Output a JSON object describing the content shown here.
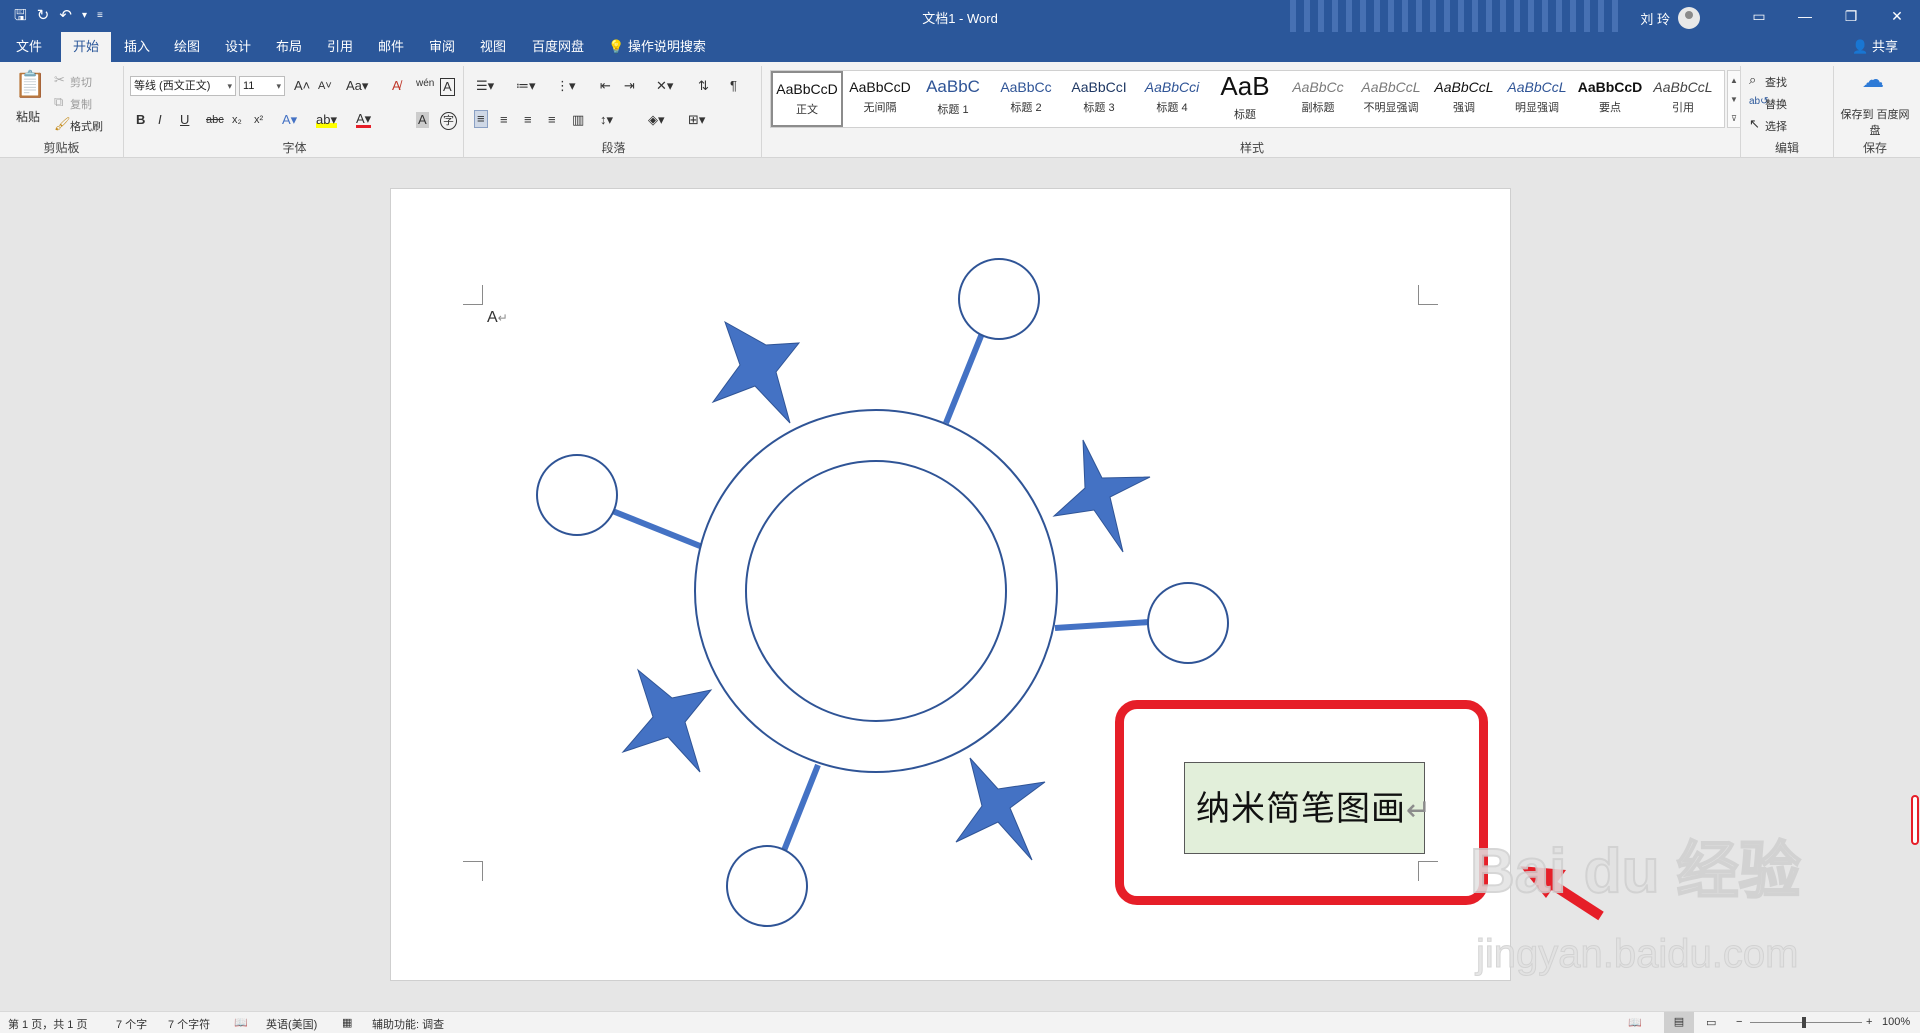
{
  "window": {
    "title": "文档1  -  Word",
    "user": "刘 玲",
    "share": "共享"
  },
  "tabs": [
    "文件",
    "开始",
    "插入",
    "绘图",
    "设计",
    "布局",
    "引用",
    "邮件",
    "审阅",
    "视图",
    "百度网盘"
  ],
  "search_label": "操作说明搜索",
  "clipboard": {
    "paste": "粘贴",
    "cut": "剪切",
    "copy": "复制",
    "format_painter": "格式刷",
    "group": "剪贴板"
  },
  "font": {
    "name": "等线 (西文正文)",
    "size": "11",
    "group": "字体"
  },
  "paragraph": {
    "group": "段落"
  },
  "styles": {
    "group": "样式",
    "items": [
      {
        "sample": "AaBbCcD",
        "name": "正文",
        "color": "#111111"
      },
      {
        "sample": "AaBbCcD",
        "name": "无间隔",
        "color": "#111111"
      },
      {
        "sample": "AaBbC",
        "name": "标题 1",
        "color": "#2f5496"
      },
      {
        "sample": "AaBbCc",
        "name": "标题 2",
        "color": "#2f5496"
      },
      {
        "sample": "AaBbCcI",
        "name": "标题 3",
        "color": "#1f3864"
      },
      {
        "sample": "AaBbCci",
        "name": "标题 4",
        "color": "#2f5496"
      },
      {
        "sample": "AaB",
        "name": "标题",
        "color": "#111111"
      },
      {
        "sample": "AaBbCc",
        "name": "副标题",
        "color": "#7a7a7a"
      },
      {
        "sample": "AaBbCcL",
        "name": "不明显强调",
        "color": "#7a7a7a"
      },
      {
        "sample": "AaBbCcL",
        "name": "强调",
        "color": "#111111"
      },
      {
        "sample": "AaBbCcL",
        "name": "明显强调",
        "color": "#2f5496"
      },
      {
        "sample": "AaBbCcD",
        "name": "要点",
        "color": "#111111"
      },
      {
        "sample": "AaBbCcL",
        "name": "引用",
        "color": "#444444"
      }
    ]
  },
  "editing": {
    "find": "查找",
    "replace": "替换",
    "select": "选择",
    "group": "编辑"
  },
  "save_cloud": {
    "label": "保存到 百度网盘",
    "group": "保存"
  },
  "document": {
    "cursor_char": "A",
    "textbox_text": "纳米简笔图画"
  },
  "watermark": {
    "main": "Bai du 经验",
    "sub": "jingyan.baidu.com"
  },
  "statusbar": {
    "page": "第 1 页，共 1 页",
    "words": "7 个字",
    "chars": "7 个字符",
    "language": "英语(美国)",
    "accessibility": "辅助功能: 调查",
    "zoom": "100%"
  },
  "colors": {
    "accent": "#2b579a",
    "shape_fill": "#4472c4",
    "shape_stroke": "#2f5496",
    "highlight": "#e61e28",
    "textbox_fill": "#e2efda"
  }
}
